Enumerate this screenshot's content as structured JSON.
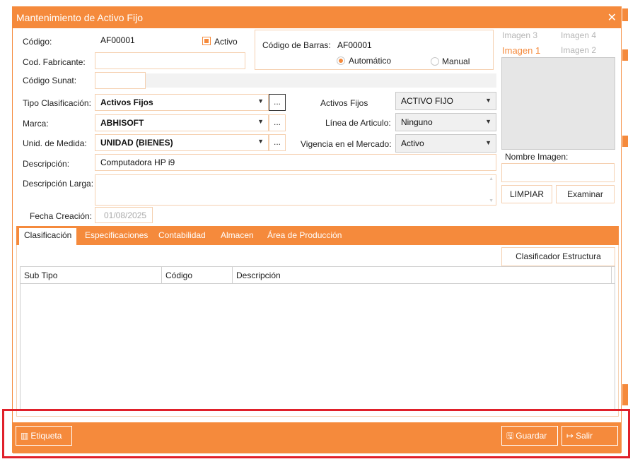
{
  "window": {
    "title": "Mantenimiento de Activo Fijo",
    "close_glyph": "✕"
  },
  "form": {
    "codigo": {
      "label": "Código:",
      "value": "AF00001"
    },
    "activo": {
      "label": "Activo",
      "checked": true
    },
    "cod_fabricante": {
      "label": "Cod. Fabricante:",
      "value": ""
    },
    "codigo_sunat": {
      "label": "Código Sunat:",
      "value": ""
    },
    "barcode": {
      "label": "Código de Barras:",
      "value": "AF00001",
      "auto_label": "Automático",
      "manual_label": "Manual",
      "selected": "auto"
    },
    "tipo_clasificacion": {
      "label": "Tipo Clasificación:",
      "value": "Activos Fijos",
      "dots": "..."
    },
    "marca": {
      "label": "Marca:",
      "value": "ABHISOFT",
      "dots": "..."
    },
    "unidad_medida": {
      "label": "Unid. de Medida:",
      "value": "UNIDAD (BIENES)",
      "dots": "..."
    },
    "activos_fijos": {
      "label": "Activos Fijos",
      "value": "ACTIVO FIJO"
    },
    "linea_articulo": {
      "label": "Línea de Articulo:",
      "value": "Ninguno"
    },
    "vigencia_mercado": {
      "label": "Vigencia en el Mercado:",
      "value": "Activo"
    },
    "descripcion": {
      "label": "Descripción:",
      "value": "Computadora HP i9"
    },
    "descripcion_larga": {
      "label": "Descripción Larga:",
      "value": ""
    },
    "fecha_creacion": {
      "label": "Fecha Creación:",
      "value": "01/08/2025"
    }
  },
  "images": {
    "tabs": [
      "Imagen 3",
      "Imagen 4",
      "Imagen 1",
      "Imagen 2"
    ],
    "active_tab": "Imagen 1",
    "nombre_label": "Nombre Imagen:",
    "nombre_value": "",
    "limpiar_label": "LIMPIAR",
    "examinar_label": "Examinar"
  },
  "tabs": [
    "Clasificación",
    "Especificaciones",
    "Contabilidad",
    "Almacen",
    "Área de Producción"
  ],
  "active_tab": "Clasificación",
  "clasificacion": {
    "button_label": "Clasificador Estructura",
    "columns": [
      "Sub Tipo",
      "Código",
      "Descripción"
    ],
    "rows": []
  },
  "footer": {
    "etiqueta_label": "Etiqueta",
    "guardar_label": "Guardar",
    "salir_label": "Salir"
  },
  "colors": {
    "accent": "#f58a3c",
    "highlight_box": "#e0202a"
  },
  "icons": {
    "scroll_up": "▲",
    "scroll_down": "▼",
    "dropdown": "▼",
    "barcode": "▥",
    "save": "🖫",
    "exit": "↦"
  }
}
